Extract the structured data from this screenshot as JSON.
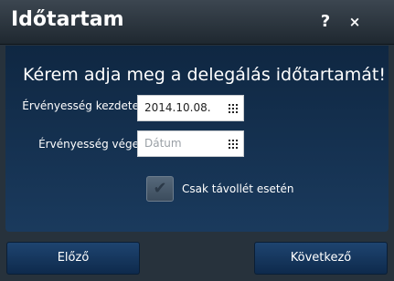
{
  "dialog": {
    "title": "Időtartam",
    "help_label": "?",
    "close_label": "×"
  },
  "main": {
    "heading": "Kérem adja meg a delegálás időtartamát!",
    "start": {
      "label": "Érvényesség kezdete",
      "value": "2014.10.08."
    },
    "end": {
      "label": "Érvényesség vége",
      "placeholder": "Dátum"
    },
    "absence_checkbox": {
      "label": "Csak távollét esetén",
      "checked": true
    }
  },
  "footer": {
    "prev_label": "Előző",
    "next_label": "Következő"
  }
}
